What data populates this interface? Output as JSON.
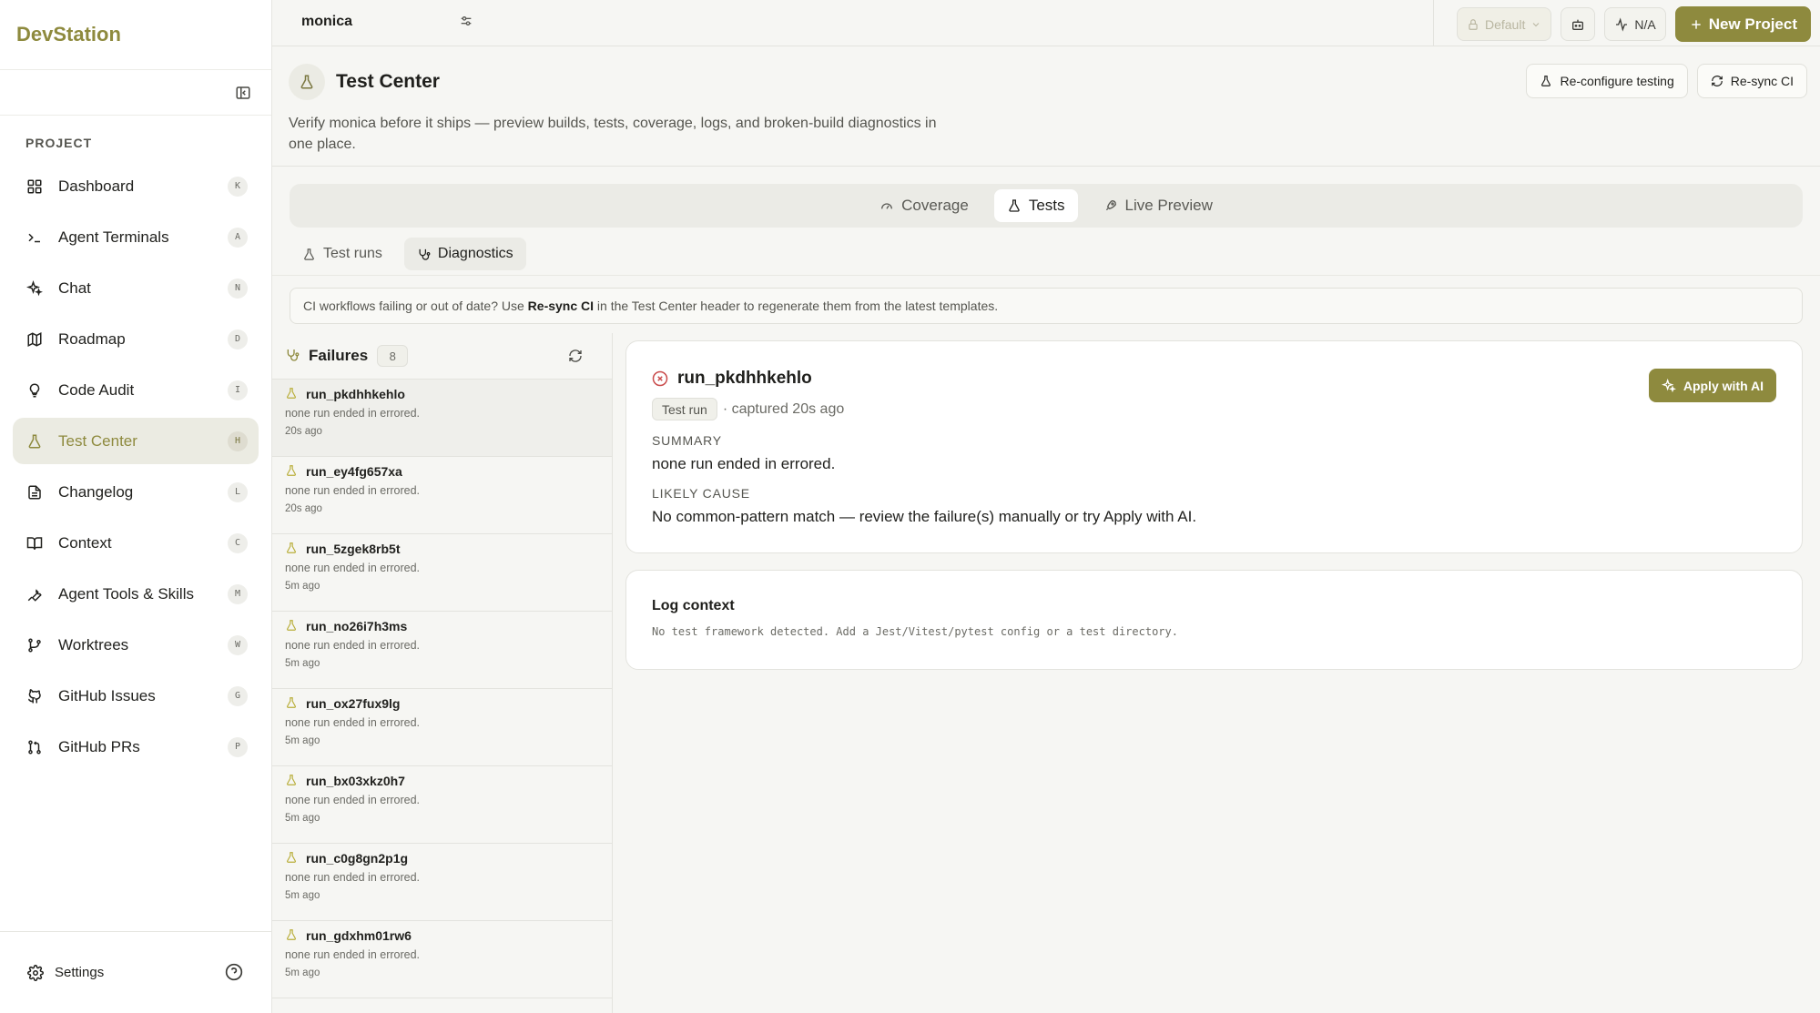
{
  "app": {
    "brand": "DevStation"
  },
  "sidebar": {
    "section_label": "PROJECT",
    "items": [
      {
        "label": "Dashboard",
        "key": "K",
        "icon": "grid-icon",
        "active": false
      },
      {
        "label": "Agent Terminals",
        "key": "A",
        "icon": "terminal-icon",
        "active": false
      },
      {
        "label": "Chat",
        "key": "N",
        "icon": "sparkles-icon",
        "active": false
      },
      {
        "label": "Roadmap",
        "key": "D",
        "icon": "map-icon",
        "active": false
      },
      {
        "label": "Code Audit",
        "key": "I",
        "icon": "lightbulb-icon",
        "active": false
      },
      {
        "label": "Test Center",
        "key": "H",
        "icon": "flask-icon",
        "active": true
      },
      {
        "label": "Changelog",
        "key": "L",
        "icon": "file-text-icon",
        "active": false
      },
      {
        "label": "Context",
        "key": "C",
        "icon": "book-icon",
        "active": false
      },
      {
        "label": "Agent Tools & Skills",
        "key": "M",
        "icon": "wrench-icon",
        "active": false
      },
      {
        "label": "Worktrees",
        "key": "W",
        "icon": "git-branch-icon",
        "active": false
      },
      {
        "label": "GitHub Issues",
        "key": "G",
        "icon": "github-icon",
        "active": false
      },
      {
        "label": "GitHub PRs",
        "key": "P",
        "icon": "git-pull-request-icon",
        "active": false
      }
    ],
    "settings_label": "Settings"
  },
  "topbar": {
    "project": "monica",
    "profile_label": "Default",
    "status_label": "N/A",
    "new_project_label": "New Project"
  },
  "header": {
    "title": "Test Center",
    "description": "Verify monica before it ships — preview builds, tests, coverage, logs, and broken-build diagnostics in one place.",
    "reconfigure_label": "Re-configure testing",
    "resync_label": "Re-sync CI"
  },
  "tabs": [
    {
      "label": "Coverage",
      "active": false
    },
    {
      "label": "Tests",
      "active": true
    },
    {
      "label": "Live Preview",
      "active": false
    }
  ],
  "subtabs": [
    {
      "label": "Test runs",
      "active": false
    },
    {
      "label": "Diagnostics",
      "active": true
    }
  ],
  "banner": {
    "prefix": "CI workflows failing or out of date? Use ",
    "emphasis": "Re-sync CI",
    "suffix": " in the Test Center header to regenerate them from the latest templates."
  },
  "failures": {
    "title": "Failures",
    "count": "8",
    "items": [
      {
        "name": "run_pkdhhkehlo",
        "message": "none run ended in errored.",
        "time": "20s ago"
      },
      {
        "name": "run_ey4fg657xa",
        "message": "none run ended in errored.",
        "time": "20s ago"
      },
      {
        "name": "run_5zgek8rb5t",
        "message": "none run ended in errored.",
        "time": "5m ago"
      },
      {
        "name": "run_no26i7h3ms",
        "message": "none run ended in errored.",
        "time": "5m ago"
      },
      {
        "name": "run_ox27fux9lg",
        "message": "none run ended in errored.",
        "time": "5m ago"
      },
      {
        "name": "run_bx03xkz0h7",
        "message": "none run ended in errored.",
        "time": "5m ago"
      },
      {
        "name": "run_c0g8gn2p1g",
        "message": "none run ended in errored.",
        "time": "5m ago"
      },
      {
        "name": "run_gdxhm01rw6",
        "message": "none run ended in errored.",
        "time": "5m ago"
      }
    ]
  },
  "detail": {
    "name": "run_pkdhhkehlo",
    "badge": "Test run",
    "captured": "· captured 20s ago",
    "summary_label": "SUMMARY",
    "summary": "none run ended in errored.",
    "cause_label": "LIKELY CAUSE",
    "cause": "No common-pattern match — review the failure(s) manually or try Apply with AI.",
    "apply_label": "Apply with AI"
  },
  "log": {
    "title": "Log context",
    "text": "No test framework detected. Add a Jest/Vitest/pytest config or a test directory."
  },
  "colors": {
    "accent": "#8e8a3e",
    "error": "#c94a4a",
    "background": "#f6f6f3"
  }
}
